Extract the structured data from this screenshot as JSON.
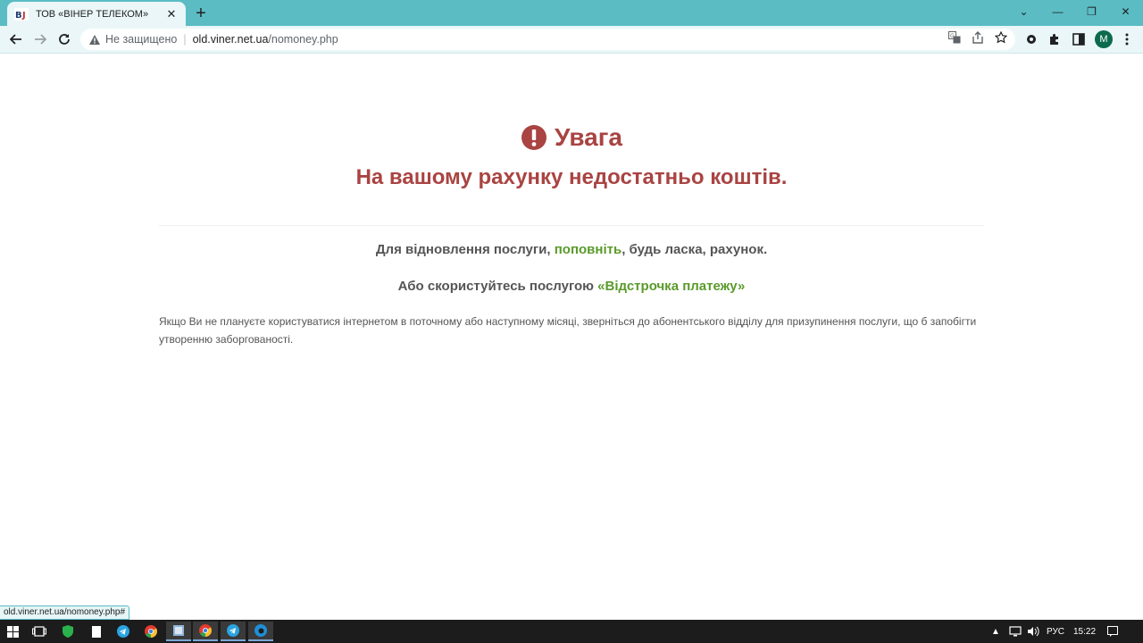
{
  "browser": {
    "tab": {
      "favicon_text": "ВJ",
      "title": "ТОВ «ВІНЕР ТЕЛЕКОМ»",
      "close_glyph": "✕"
    },
    "new_tab_glyph": "+",
    "window_controls": {
      "list_glyph": "⌄",
      "minimize_glyph": "—",
      "maximize_glyph": "❐",
      "close_glyph": "✕"
    },
    "address": {
      "security_label": "Не защищено",
      "separator": "|",
      "host": "old.viner.net.ua",
      "path": "/nomoney.php"
    },
    "profile_initial": "M"
  },
  "page": {
    "heading": "Увага",
    "subheading": "На вашому рахунку недостатньо коштів.",
    "line1": {
      "before": "Для відновлення послуги, ",
      "link": "поповніть",
      "after": ", будь ласка, рахунок."
    },
    "line2": {
      "before": "Або скористуйтесь послугою ",
      "link": "«Відстрочка платежу»"
    },
    "note": "Якщо Ви не плануєте користуватися інтернетом в поточному або наступному місяці, зверніться до абонентського відділу для призупинення послуги, що б запобігти утворенню заборгованості.",
    "accent_color": "#a94442",
    "link_color": "#5a9a2a"
  },
  "status_url": "old.viner.net.ua/nomoney.php#",
  "taskbar": {
    "language": "РУС",
    "time": "15:22"
  }
}
